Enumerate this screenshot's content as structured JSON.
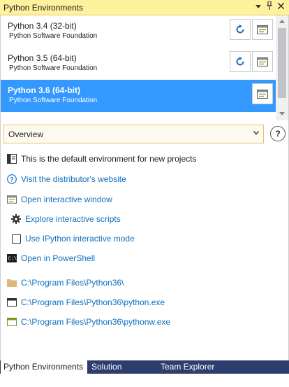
{
  "panel": {
    "title": "Python Environments"
  },
  "environments": [
    {
      "name": "Python 3.4 (32-bit)",
      "publisher": "Python Software Foundation",
      "selected": false
    },
    {
      "name": "Python 3.5 (64-bit)",
      "publisher": "Python Software Foundation",
      "selected": false
    },
    {
      "name": "Python 3.6 (64-bit)",
      "publisher": "Python Software Foundation",
      "selected": true
    }
  ],
  "view_select": {
    "value": "Overview"
  },
  "help_label": "?",
  "overview": {
    "default_env": "This is the default environment for new projects",
    "distributor": "Visit the distributor's website",
    "open_interactive": "Open interactive window",
    "explore_scripts": "Explore interactive scripts",
    "use_ipython": "Use IPython interactive mode",
    "open_powershell": "Open in PowerShell",
    "prefix_path": "C:\\Program Files\\Python36\\",
    "python_exe": "C:\\Program Files\\Python36\\python.exe",
    "pythonw_exe": "C:\\Program Files\\Python36\\pythonw.exe"
  },
  "tabs": [
    {
      "label": "Python Environments",
      "active": true
    },
    {
      "label": "Solution Explorer",
      "active": false
    },
    {
      "label": "Team Explorer",
      "active": false
    }
  ],
  "colors": {
    "accent": "#3399ff",
    "link": "#0e70c0",
    "titlebar": "#fff29d",
    "tabbar": "#2d3e6e"
  }
}
